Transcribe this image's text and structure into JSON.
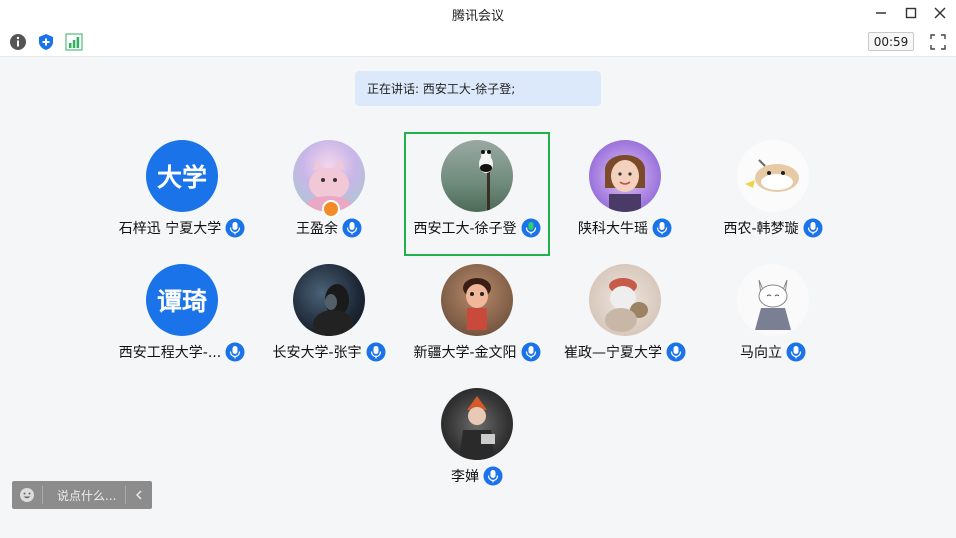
{
  "window": {
    "title": "腾讯会议"
  },
  "toolbar": {
    "timer": "00:59"
  },
  "speaking": {
    "text": "正在讲话: 西安工大-徐子登;"
  },
  "participants": [
    {
      "name": "石梓迅 宁夏大学",
      "avatar_text": "大学"
    },
    {
      "name": "王盈余"
    },
    {
      "name": "西安工大-徐子登",
      "active": true
    },
    {
      "name": "陕科大牛瑶"
    },
    {
      "name": "西农-韩梦璇"
    },
    {
      "name": "西安工程大学-...",
      "avatar_text": "谭琦"
    },
    {
      "name": "长安大学-张宇"
    },
    {
      "name": "新疆大学-金文阳"
    },
    {
      "name": "崔政—宁夏大学"
    },
    {
      "name": "马向立"
    },
    {
      "name": "李婵"
    }
  ],
  "chat": {
    "placeholder": "说点什么..."
  },
  "colors": {
    "accent": "#1a73e8",
    "active_border": "#22b14c",
    "mic_blue": "#1a73e8",
    "mic_active": "#22b14c"
  }
}
